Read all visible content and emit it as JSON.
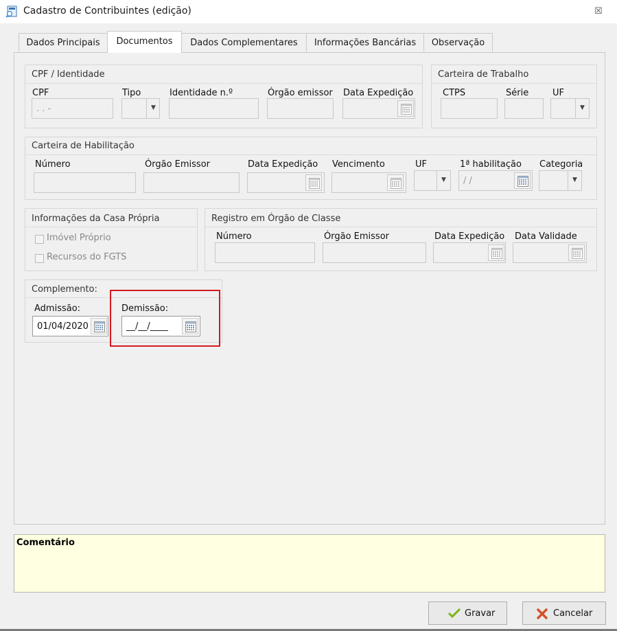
{
  "window": {
    "title": "Cadastro de Contribuintes (edição)",
    "close_glyph": "☒"
  },
  "tabs": [
    {
      "label": "Dados Principais",
      "active": false
    },
    {
      "label": "Documentos",
      "active": true
    },
    {
      "label": "Dados Complementares",
      "active": false
    },
    {
      "label": "Informações Bancárias",
      "active": false
    },
    {
      "label": "Observação",
      "active": false
    }
  ],
  "cpf_group": {
    "title": "CPF / Identidade",
    "labels": {
      "cpf": "CPF",
      "tipo": "Tipo",
      "identidade": "Identidade n.º",
      "orgao": "Órgão emissor",
      "data_expedicao": "Data Expedição"
    },
    "cpf_value": "  .   .   -",
    "identidade_value": "",
    "orgao_value": "",
    "data_expedicao_value": ""
  },
  "ctps_group": {
    "title": "Carteira de Trabalho",
    "labels": {
      "ctps": "CTPS",
      "serie": "Série",
      "uf": "UF"
    }
  },
  "cnh_group": {
    "title": "Carteira de Habilitação",
    "labels": {
      "numero": "Número",
      "orgao": "Órgão Emissor",
      "data_expedicao": "Data Expedição",
      "vencimento": "Vencimento",
      "uf": "UF",
      "primeira": "1ª habilitação",
      "categoria": "Categoria"
    },
    "primeira_value": " /  /"
  },
  "casa_group": {
    "title": "Informações da Casa Própria",
    "imovel_label": "Imóvel Próprio",
    "fgts_label": "Recursos do FGTS"
  },
  "registro_group": {
    "title": "Registro em Órgão de Classe",
    "labels": {
      "numero": "Número",
      "orgao": "Órgão Emissor",
      "data_expedicao": "Data Expedição",
      "data_validade": "Data Validade"
    }
  },
  "complemento_group": {
    "title": "Complemento:",
    "admissao_label": "Admissão:",
    "admissao_value": "01/04/2020",
    "demissao_label": "Demissão:",
    "demissao_value": "__/__/____"
  },
  "comment": {
    "label": "Comentário"
  },
  "buttons": {
    "save": "Gravar",
    "cancel": "Cancelar"
  },
  "colors": {
    "highlight": "#d3191f",
    "comment_bg": "#ffffe1",
    "save_check": "#7bb31a",
    "cancel_x": "#d2522a"
  }
}
